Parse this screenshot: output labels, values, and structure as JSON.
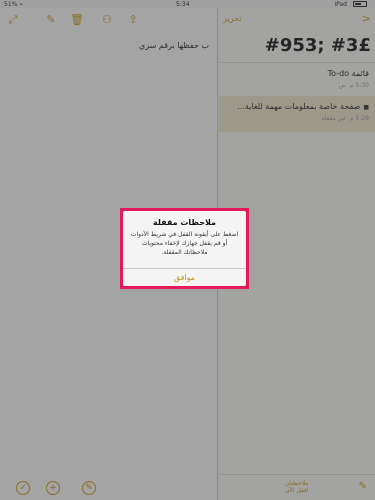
{
  "status_bar": {
    "signal": "51% ⌁",
    "time": "5:34",
    "battery_label": "iPad"
  },
  "editor": {
    "body_text": "ب حفظها برقم سري",
    "toolbar_icons": [
      "trash-icon",
      "compose-icon",
      "share-icon"
    ],
    "bottom_icons": [
      "camera-icon",
      "add-icon",
      "checklist-icon"
    ]
  },
  "notes_list": {
    "edit_label": "تحرير",
    "title": "#953; #3£",
    "items": [
      {
        "title": "قائمة To-do",
        "time": "5:30 م",
        "meta": "س"
      },
      {
        "title": "صفحة خاصة بمعلومات مهمة للغاية...",
        "time": "5:29 م",
        "meta": "غير مقفلة"
      }
    ],
    "footer": {
      "count_line1": "ملاحظتان",
      "count_line2": "اقفل الآن"
    }
  },
  "alert": {
    "title": "ملاحظات مقفلة",
    "message": "اضغط على أيقونة القفل في شريط الأدوات أو قم بقفل جهازك لإخفاء محتويات ملاحظاتك المقفلة.",
    "ok_label": "موافق"
  },
  "colors": {
    "accent": "#c59a1a",
    "highlight": "#e51a5a",
    "selected_row": "#ece5c9"
  }
}
